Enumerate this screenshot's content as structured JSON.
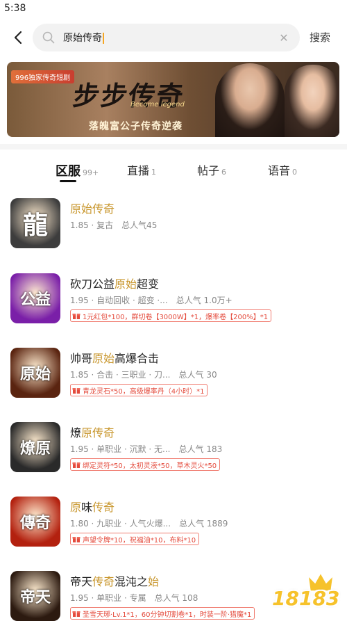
{
  "status_bar": {
    "time": "5:38"
  },
  "search": {
    "query": "原始传奇",
    "submit_label": "搜索"
  },
  "banner": {
    "tag": "996独家传奇短剧",
    "title": "步步传奇",
    "subtitle_en": "Become legend",
    "subtitle": "落魄富公子传奇逆袭"
  },
  "tabs": [
    {
      "label": "区服",
      "count": "99+",
      "active": true
    },
    {
      "label": "直播",
      "count": "1",
      "active": false
    },
    {
      "label": "帖子",
      "count": "6",
      "active": false
    },
    {
      "label": "语音",
      "count": "0",
      "active": false
    }
  ],
  "games": [
    {
      "title_parts": [
        {
          "text": "原始传奇",
          "hl": true
        }
      ],
      "meta": "1.85 · 复古",
      "popularity": "总人气45",
      "gift": "",
      "icon_char": "龍",
      "icon_bg": "#3d3d3d"
    },
    {
      "title_parts": [
        {
          "text": "砍刀公益",
          "hl": false
        },
        {
          "text": "原始",
          "hl": true
        },
        {
          "text": "超变",
          "hl": false
        }
      ],
      "meta": "1.95 · 自动回收 · 超变 ·...",
      "popularity": "总人气 1.0万+",
      "gift": "1元红包*100，群切卷【3000W】*1，爆率卷【200%】*1",
      "icon_char": "公益",
      "icon_bg": "#7a1fa8"
    },
    {
      "title_parts": [
        {
          "text": "帅哥",
          "hl": false
        },
        {
          "text": "原始",
          "hl": true
        },
        {
          "text": "高爆合击",
          "hl": false
        }
      ],
      "meta": "1.85 · 合击 · 三职业 · 刀...",
      "popularity": "总人气 30",
      "gift": "青龙灵石*50，高级爆率丹（4小时）*1",
      "icon_char": "原始",
      "icon_bg": "#5a2410"
    },
    {
      "title_parts": [
        {
          "text": "燎",
          "hl": false
        },
        {
          "text": "原",
          "hl": true
        },
        {
          "text": "传奇",
          "hl": true
        }
      ],
      "meta": "1.95 · 单职业 · 沉默 · 无...",
      "popularity": "总人气 183",
      "gift": "绑定灵符*50，太初灵液*50，草木灵火*50",
      "icon_char": "燎原",
      "icon_bg": "#2a2a2a"
    },
    {
      "title_parts": [
        {
          "text": "原",
          "hl": true
        },
        {
          "text": "味",
          "hl": false
        },
        {
          "text": "传奇",
          "hl": true
        }
      ],
      "meta": "1.80 · 九职业 · 人气火爆...",
      "popularity": "总人气 1889",
      "gift": "声望令牌*10，祝福油*10，布料*10",
      "icon_char": "傳奇",
      "icon_bg": "#b3210f"
    },
    {
      "title_parts": [
        {
          "text": "帝天",
          "hl": false
        },
        {
          "text": "传奇",
          "hl": true
        },
        {
          "text": "混沌之",
          "hl": false
        },
        {
          "text": "始",
          "hl": true
        }
      ],
      "meta": "1.95 · 单职业 · 专属",
      "popularity": "总人气 108",
      "gift": "圣雪天琊·Lv.1*1，60分钟切割卷*1，时装一阶·猎魔*1",
      "icon_char": "帝天",
      "icon_bg": "#2c1a10"
    }
  ],
  "watermark": "18183"
}
